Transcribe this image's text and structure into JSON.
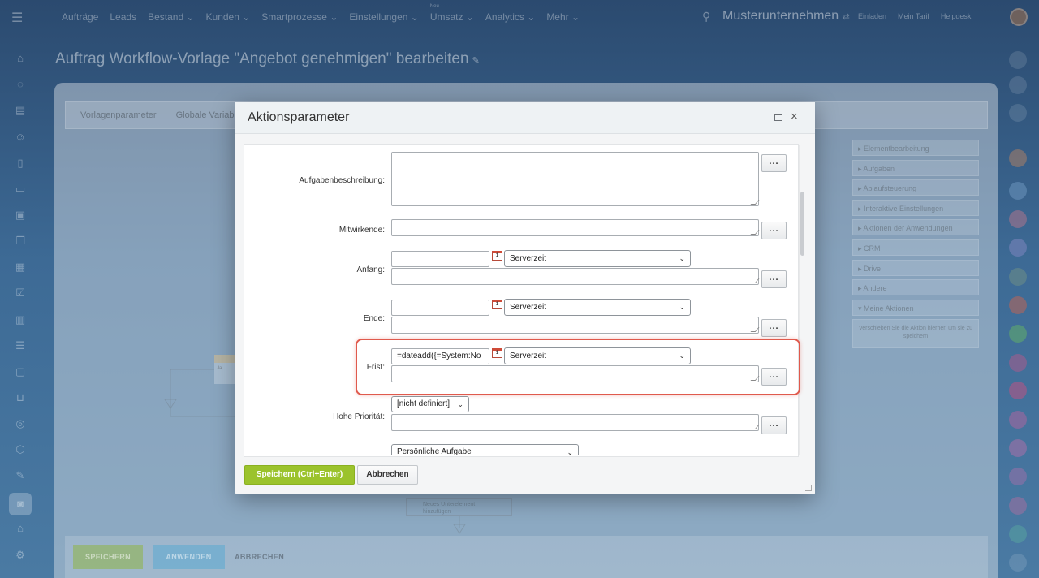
{
  "topnav": {
    "menu": [
      "Aufträge",
      "Leads",
      "Bestand",
      "Kunden",
      "Smartprozesse",
      "Einstellungen",
      "Umsatz",
      "Analytics",
      "Mehr"
    ],
    "umsatz_badge": "Neu",
    "company": "Musterunternehmen",
    "links": [
      "Einladen",
      "Mein Tarif",
      "Helpdesk"
    ]
  },
  "page": {
    "title": "Auftrag Workflow-Vorlage \"Angebot genehmigen\" bearbeiten"
  },
  "tabs": [
    "Vorlagenparameter",
    "Globale Variablen"
  ],
  "activity_panel": {
    "items": [
      "Elementbearbeitung",
      "Aufgaben",
      "Ablaufsteuerung",
      "Interaktive Einstellungen",
      "Aktionen der Anwendungen",
      "CRM",
      "Drive",
      "Andere",
      "Meine Aktionen"
    ],
    "note": "Verschieben Sie die Aktion hierher, um sie zu speichern"
  },
  "workflow": {
    "box_label": "Neues Unterelement hinzufügen",
    "ja_label": "Ja"
  },
  "bottom": {
    "save": "SPEICHERN",
    "apply": "ANWENDEN",
    "cancel": "ABBRECHEN"
  },
  "dialog": {
    "title": "Aktionsparameter",
    "dots": "...",
    "fields": {
      "description_label": "Aufgabenbeschreibung:",
      "participants_label": "Mitwirkende:",
      "start_label": "Anfang:",
      "end_label": "Ende:",
      "deadline_label": "Frist:",
      "priority_label": "Hohe Priorität:"
    },
    "timezone": "Serverzeit",
    "deadline_value": "=dateadd({=System:No",
    "priority_value": "[nicht definiert]",
    "task_type_value": "Persönliche Aufgabe",
    "calendar_glyph": "1",
    "save_button": "Speichern (Ctrl+Enter)",
    "cancel_button": "Abbrechen"
  },
  "colors": {
    "accent_green": "#9bc32c",
    "highlight_red": "#e05a4d"
  }
}
